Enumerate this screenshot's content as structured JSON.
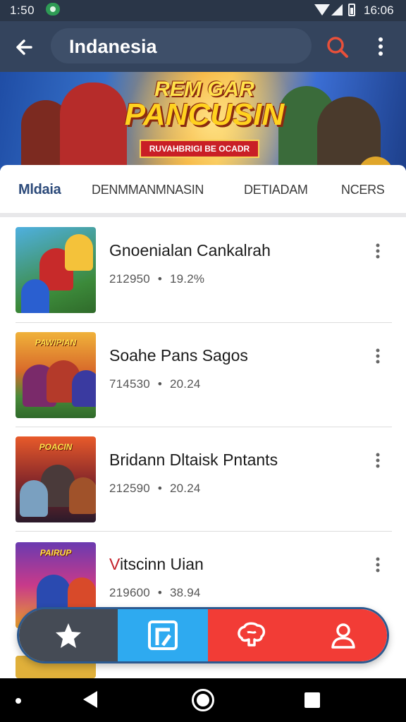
{
  "status_bar": {
    "time_left": "1:50",
    "time_right": "16:06",
    "icons": [
      "eye-icon",
      "wifi-icon",
      "signal-icon",
      "battery-icon"
    ]
  },
  "app_bar": {
    "title": "Indanesia",
    "icons": {
      "back": "back-arrow-icon",
      "search": "search-icon",
      "more": "more-vert-icon"
    },
    "colors": {
      "background": "#34445d",
      "search_accent": "#e8503a"
    }
  },
  "banner": {
    "title_line1": "REM GAR",
    "title_line2": "PANCUSIN",
    "ribbon": "RUVAHBRIGI BE OCADR"
  },
  "tabs": [
    {
      "label": "Mldaia",
      "active": true
    },
    {
      "label": "DENMMANMNASIN",
      "active": false
    },
    {
      "label": "DETIADAM",
      "active": false
    },
    {
      "label": "NCERS",
      "active": false
    }
  ],
  "list": {
    "items": [
      {
        "title": "Gnoenialan Cankalrah",
        "downloads": "212950",
        "separator": "•",
        "rating": "19.2%"
      },
      {
        "title": "Soahe Pans Sagos",
        "downloads": "714530",
        "separator": "•",
        "rating": "20.24"
      },
      {
        "title": "Bridann Dltaisk Pntants",
        "downloads": "212590",
        "separator": "•",
        "rating": "20.24"
      },
      {
        "title_first_letter": "V",
        "title_rest": "itscinn Uian",
        "downloads": "219600",
        "separator": "•",
        "rating": "38.94"
      }
    ],
    "thumb_words": [
      "",
      "PAWIPIAN",
      "POACIN",
      "PAIRUP"
    ]
  },
  "bottom_nav": {
    "items": [
      {
        "icon": "star-icon",
        "color": "#454b55"
      },
      {
        "icon": "app-tile-icon",
        "color": "#2eaaf0"
      },
      {
        "icon": "brain-icon",
        "color": "#f23c36"
      },
      {
        "icon": "profile-icon",
        "color": "#f23c36"
      }
    ]
  },
  "system_nav": {
    "icons": [
      "dot-icon",
      "back-triangle-icon",
      "home-circle-icon",
      "recents-square-icon"
    ]
  }
}
